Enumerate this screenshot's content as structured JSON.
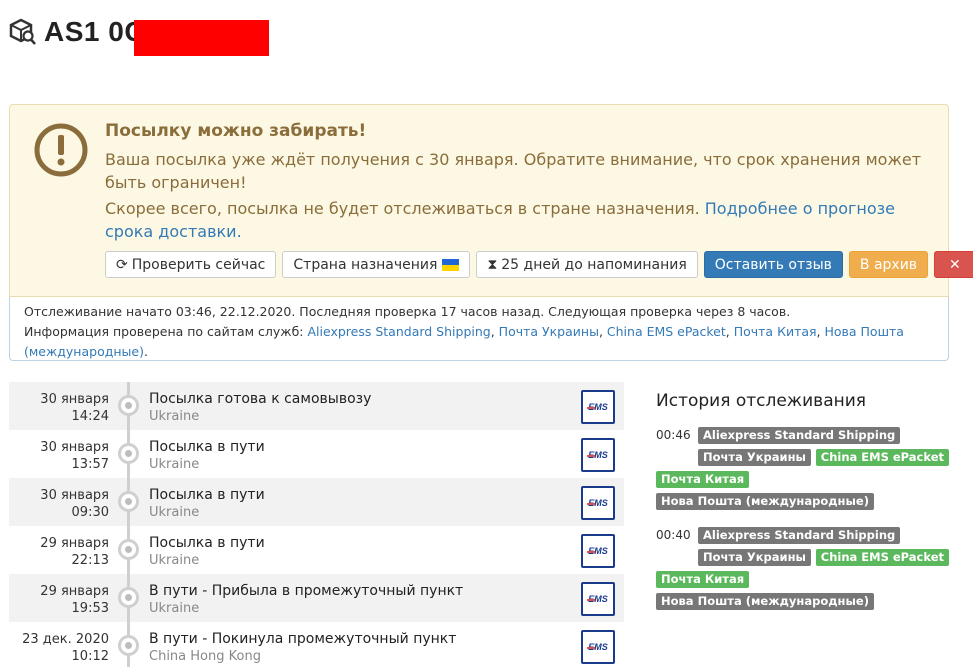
{
  "header": {
    "tracking_number": "AS1         0CN",
    "logo_icon": "package-search-icon"
  },
  "alert": {
    "title": "Посылку можно забирать!",
    "text": "Ваша посылка уже ждёт получения с 30 января. Обратите внимание, что срок хранения может быть ограничен!",
    "text2": "Скорее всего, посылка не будет отслеживаться в стране назначения.",
    "link": "Подробнее о прогнозе срока доставки.",
    "buttons": {
      "check_now": "Проверить сейчас",
      "destination": "Страна назначения",
      "reminder": "25 дней до напоминания",
      "review": "Оставить отзыв",
      "archive": "В архив",
      "delete": "✕"
    }
  },
  "info": {
    "line1": "Отслеживание начато 03:46, 22.12.2020. Последняя проверка 17 часов назад. Следующая проверка через 8 часов.",
    "line2_prefix": "Информация проверена по сайтам служб:",
    "services": [
      "Aliexpress Standard Shipping",
      "Почта Украины",
      "China EMS ePacket",
      "Почта Китая",
      "Нова Пошта (международные)"
    ]
  },
  "timeline": [
    {
      "date": "30 января",
      "time": "14:24",
      "status": "Посылка готова к самовывозу",
      "location": "Ukraine"
    },
    {
      "date": "30 января",
      "time": "13:57",
      "status": "Посылка в пути",
      "location": "Ukraine"
    },
    {
      "date": "30 января",
      "time": "09:30",
      "status": "Посылка в пути",
      "location": "Ukraine"
    },
    {
      "date": "29 января",
      "time": "22:13",
      "status": "Посылка в пути",
      "location": "Ukraine"
    },
    {
      "date": "29 января",
      "time": "19:53",
      "status": "В пути - Прибыла в промежуточный пункт",
      "location": "Ukraine"
    },
    {
      "date": "23 дек. 2020",
      "time": "10:12",
      "status": "В пути - Покинула промежуточный пункт",
      "location": "China Hong Kong"
    }
  ],
  "carrier_logo": "EMS",
  "history": {
    "title": "История отслеживания",
    "groups": [
      {
        "time": "00:46",
        "labels": [
          {
            "text": "Aliexpress Standard Shipping",
            "color": "grey"
          },
          {
            "text": "Почта Украины",
            "color": "grey"
          },
          {
            "text": "China EMS ePacket",
            "color": "green"
          },
          {
            "text": "Почта Китая",
            "color": "green"
          },
          {
            "text": "Нова Пошта (международные)",
            "color": "grey"
          }
        ]
      },
      {
        "time": "00:40",
        "labels": [
          {
            "text": "Aliexpress Standard Shipping",
            "color": "grey"
          },
          {
            "text": "Почта Украины",
            "color": "grey"
          },
          {
            "text": "China EMS ePacket",
            "color": "green"
          },
          {
            "text": "Почта Китая",
            "color": "green"
          },
          {
            "text": "Нова Пошта (международные)",
            "color": "grey"
          }
        ]
      }
    ]
  },
  "colors": {
    "alert_bg": "#fcf8e3",
    "alert_text": "#8a6d3b",
    "link": "#337ab7",
    "label_grey": "#777777",
    "label_green": "#5cb85c"
  }
}
